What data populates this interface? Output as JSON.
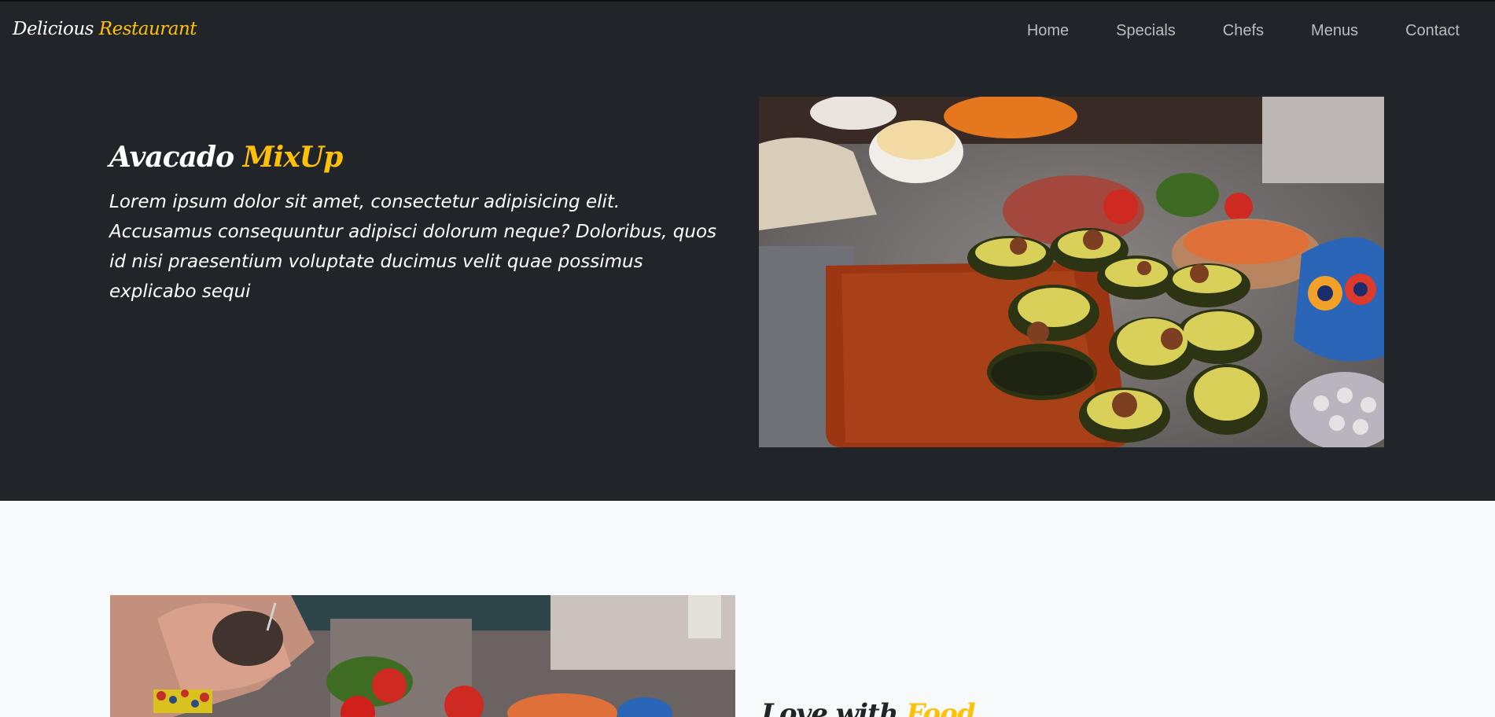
{
  "navbar": {
    "brand_main": "Delicious",
    "brand_accent": "Restaurant",
    "links": [
      {
        "label": "Home"
      },
      {
        "label": "Specials"
      },
      {
        "label": "Chefs"
      },
      {
        "label": "Menus"
      },
      {
        "label": "Contact"
      }
    ]
  },
  "hero": {
    "title_main": "Avacado",
    "title_accent": "MixUp",
    "text": "Lorem ipsum dolor sit amet, consectetur adipisicing elit. Accusamus consequuntur adipisci dolorum neque? Doloribus, quos id nisi praesentium voluptate ducimus velit quae possimus explicabo sequi"
  },
  "section_two": {
    "title_main": "Love with",
    "title_accent": "Food"
  },
  "colors": {
    "dark_bg": "#212529",
    "accent": "#ffc107",
    "light_bg": "#f8f9fa"
  }
}
